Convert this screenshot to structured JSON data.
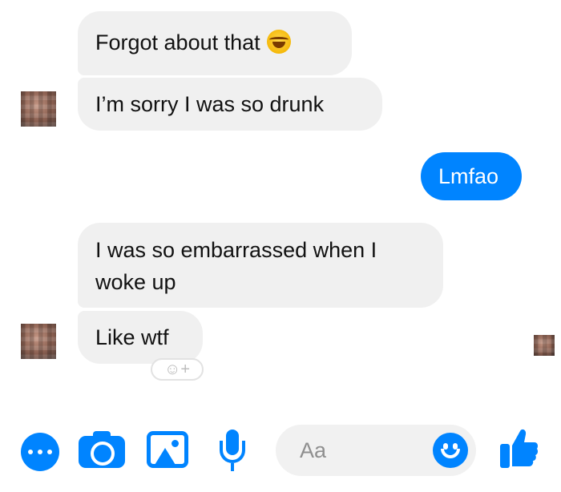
{
  "messages": {
    "forgot": "Forgot about that",
    "sorry": "I’m sorry I was so drunk",
    "lmfao": "Lmfao",
    "embarrassed": "I was so embarrassed when I woke up",
    "likewtf": "Like wtf"
  },
  "reaction": {
    "label": "☺+"
  },
  "composer": {
    "placeholder": "Aa"
  },
  "colors": {
    "accent": "#0084ff",
    "incoming_bubble": "#f0f0f0"
  },
  "icons": [
    "more-icon",
    "camera-icon",
    "image-icon",
    "mic-icon",
    "emoji-icon",
    "like-icon",
    "laughing-emoji-icon"
  ]
}
